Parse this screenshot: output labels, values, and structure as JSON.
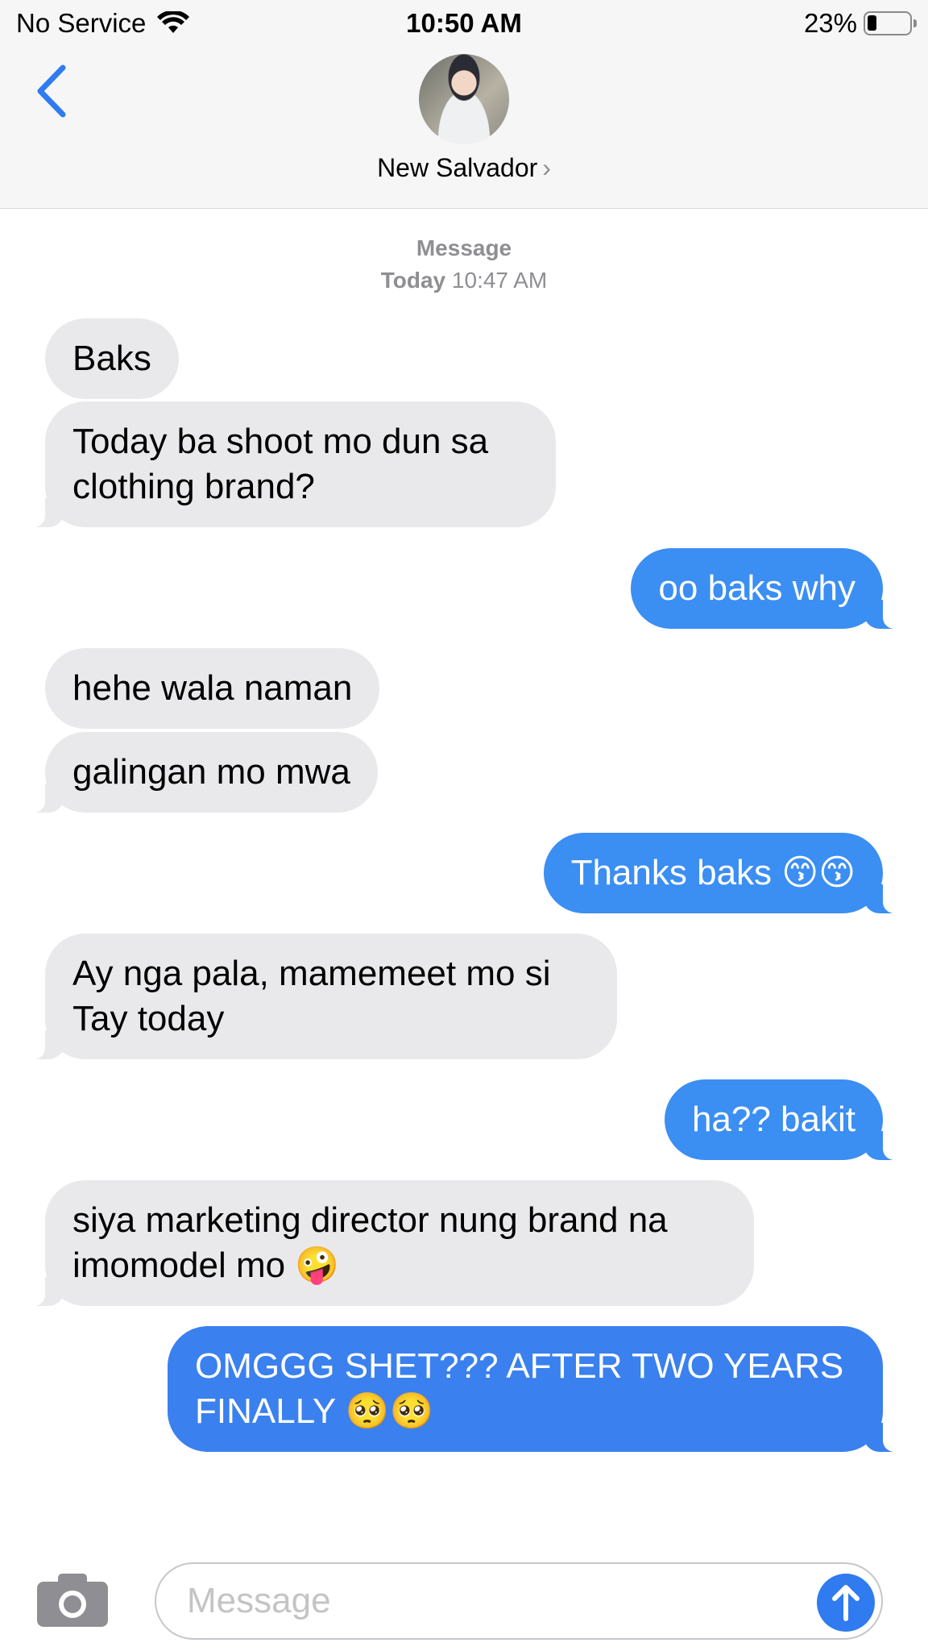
{
  "status_bar": {
    "carrier": "No Service",
    "time": "10:50 AM",
    "battery_percent": "23%",
    "battery_level": 0.23
  },
  "header": {
    "contact_name": "New Salvador",
    "contact_chevron": "›"
  },
  "conversation": {
    "service_label": "Message",
    "date_label": "Today",
    "time_label": "10:47 AM",
    "messages": [
      {
        "from": "them",
        "text": "Baks"
      },
      {
        "from": "them",
        "text": "Today ba shoot mo dun sa clothing brand?"
      },
      {
        "from": "me",
        "text": "oo baks why"
      },
      {
        "from": "them",
        "text": "hehe wala naman"
      },
      {
        "from": "them",
        "text": "galingan mo mwa"
      },
      {
        "from": "me",
        "text": "Thanks baks 😙😙"
      },
      {
        "from": "them",
        "text": "Ay nga pala, mamemeet mo si Tay today"
      },
      {
        "from": "me",
        "text": "ha?? bakit"
      },
      {
        "from": "them",
        "text": "siya marketing director nung brand na imomodel mo 🤪"
      },
      {
        "from": "me",
        "text": "OMGGG SHET??? AFTER TWO YEARS FINALLY 🥺🥺"
      }
    ]
  },
  "composer": {
    "placeholder": "Message"
  },
  "colors": {
    "incoming_bubble": "#e9e9eb",
    "outgoing_bubble": "#3b8ef2",
    "accent": "#2f7bef"
  }
}
